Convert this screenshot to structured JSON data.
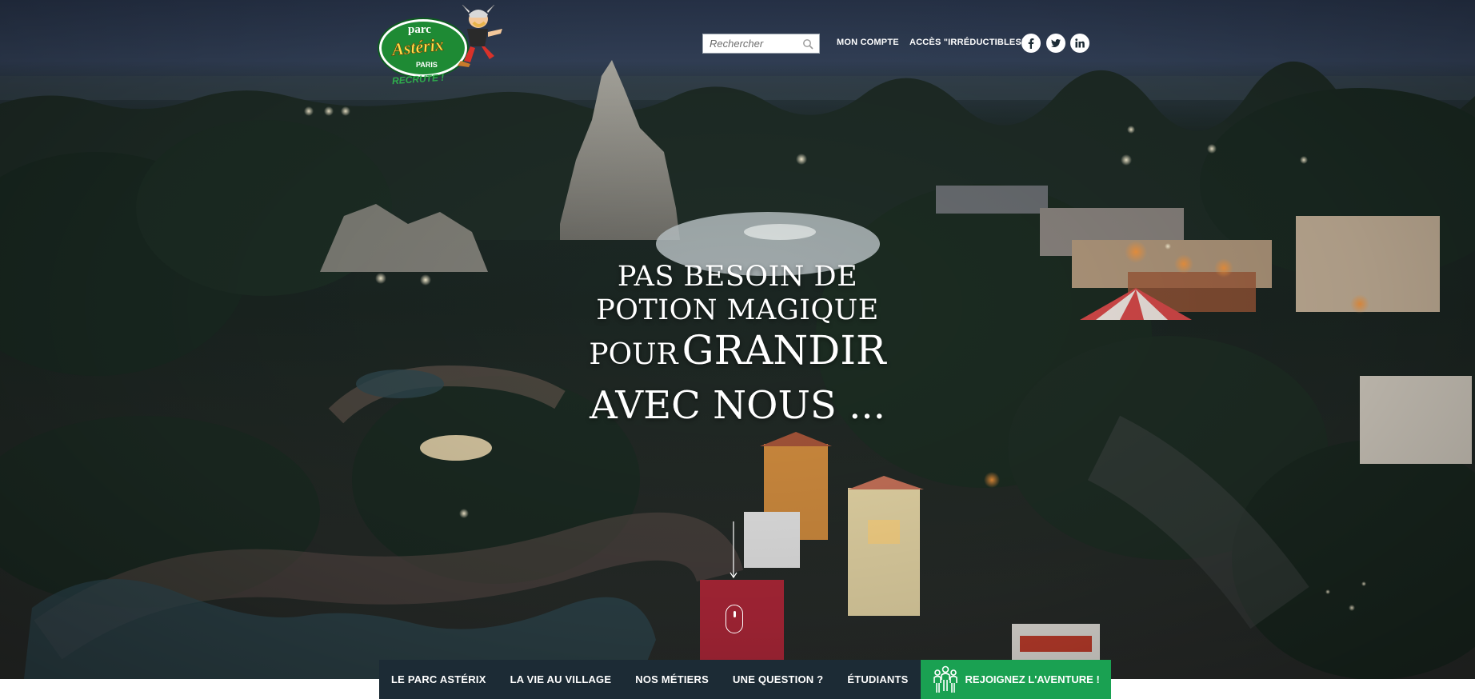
{
  "header": {
    "logo": {
      "line1": "parc",
      "line2": "Astérix",
      "line3": "PARIS",
      "tagline": "RECRUTE !"
    },
    "search": {
      "placeholder": "Rechercher",
      "icon": "search-icon"
    },
    "links": {
      "account": "MON COMPTE",
      "irreductibles": "ACCÈS \"IRRÉDUCTIBLES\""
    },
    "social": [
      {
        "name": "facebook",
        "icon": "facebook-icon"
      },
      {
        "name": "twitter",
        "icon": "twitter-icon"
      },
      {
        "name": "linkedin",
        "icon": "linkedin-icon"
      }
    ]
  },
  "hero": {
    "line1": "PAS BESOIN DE",
    "line2": "POTION MAGIQUE",
    "line3_small": "POUR",
    "line3_big": "GRANDIR",
    "line4": "AVEC NOUS ..."
  },
  "nav": {
    "items": [
      "LE PARC ASTÉRIX",
      "LA VIE AU VILLAGE",
      "NOS MÉTIERS",
      "UNE QUESTION ?",
      "ÉTUDIANTS"
    ],
    "cta": "REJOIGNEZ L'AVENTURE !",
    "cta_icon": "people-group-icon"
  },
  "colors": {
    "nav_bg": "#1c2b35",
    "cta_bg": "#1aa152",
    "logo_green": "#1e8a34",
    "text_light": "#ffffff"
  }
}
